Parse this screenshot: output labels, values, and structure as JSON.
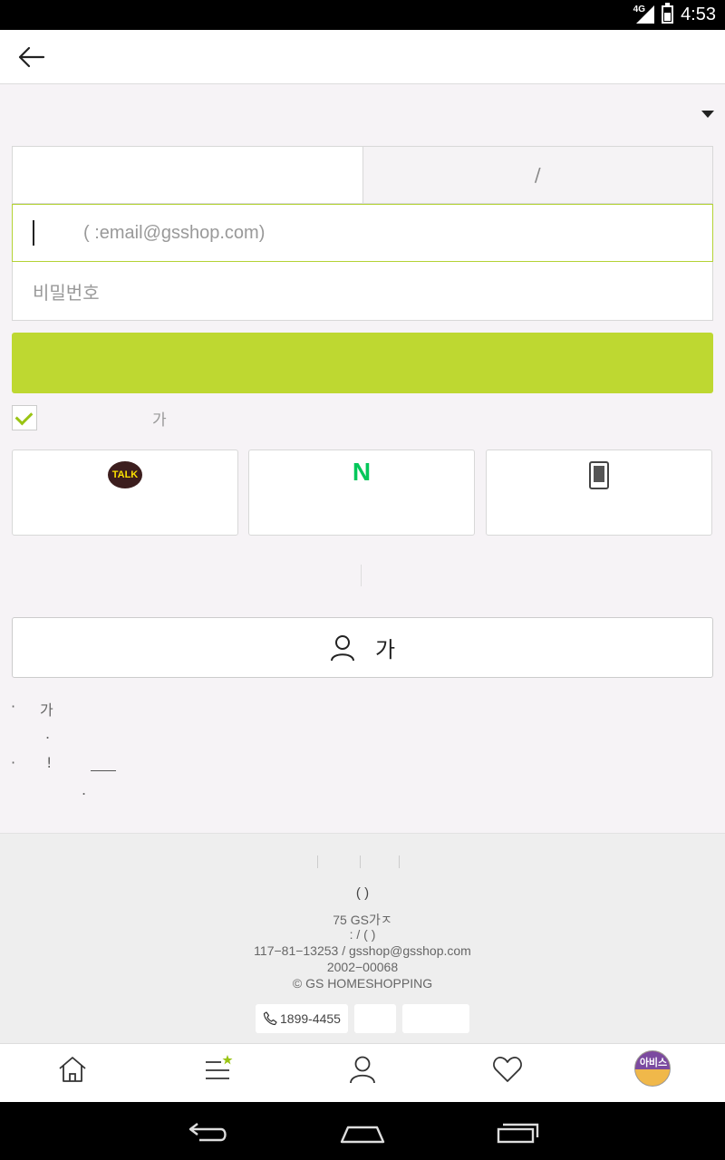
{
  "status_bar": {
    "network": "4G",
    "time": "4:53"
  },
  "tabs": [
    {
      "label": ""
    },
    {
      "label": "/"
    }
  ],
  "email_field": {
    "placeholder": "(  :email@gsshop.com)"
  },
  "password_field": {
    "placeholder": "비밀번호"
  },
  "login_button": {
    "label": ""
  },
  "auto_login": {
    "label": "가"
  },
  "social_logins": [
    {
      "name": "kakao",
      "icon_text": "TALK"
    },
    {
      "name": "naver",
      "icon_text": "N"
    },
    {
      "name": "phone",
      "icon_text": ""
    }
  ],
  "join_button": {
    "label": "가"
  },
  "notes": [
    {
      "bullet": "·",
      "text": "가",
      "sub": "."
    },
    {
      "bullet": "·",
      "text": "!",
      "sub": "."
    }
  ],
  "footer": {
    "company": "( )",
    "address": "75 GS가ㅈ",
    "ceo_line": ":     /        ( )",
    "biz_line": "117−81−13253 / gsshop@gsshop.com",
    "reg_line": "2002−00068",
    "copyright": "© GS HOMESHOPPING",
    "phone": "1899-4455"
  },
  "bottom_nav": {
    "avatar_text": "아비스",
    "items": [
      "home-icon",
      "menu-icon",
      "user-icon",
      "heart-icon",
      "avatar"
    ]
  },
  "colors": {
    "accent": "#bed831",
    "focus_border": "#b4d335",
    "check": "#9ac414"
  }
}
